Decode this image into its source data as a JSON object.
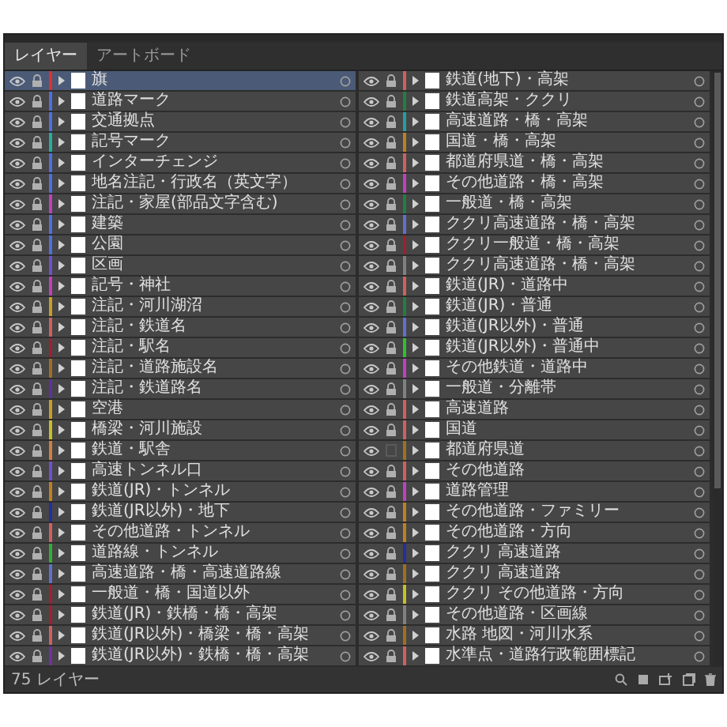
{
  "tabs": [
    {
      "label": "レイヤー",
      "selected": true
    },
    {
      "label": "アートボード",
      "selected": false
    }
  ],
  "layers": [
    {
      "name": "旗",
      "color": "#e03030",
      "locked": true,
      "selected": true
    },
    {
      "name": "道路マーク",
      "color": "#4f6fe0",
      "locked": true,
      "selected": false
    },
    {
      "name": "交通拠点",
      "color": "#4f6fe0",
      "locked": true,
      "selected": false
    },
    {
      "name": "記号マーク",
      "color": "#20b0a0",
      "locked": true,
      "selected": false
    },
    {
      "name": "インターチェンジ",
      "color": "#4f6fe0",
      "locked": true,
      "selected": false
    },
    {
      "name": "地名注記・行政名（英文字）",
      "color": "#4f6fe0",
      "locked": true,
      "selected": false
    },
    {
      "name": "注記・家屋(部品文字含む)",
      "color": "#c040c0",
      "locked": true,
      "selected": false
    },
    {
      "name": "建築",
      "color": "#4f6fe0",
      "locked": true,
      "selected": false
    },
    {
      "name": "公園",
      "color": "#4f6fe0",
      "locked": true,
      "selected": false
    },
    {
      "name": "区画",
      "color": "#7050d0",
      "locked": true,
      "selected": false
    },
    {
      "name": "記号・神社",
      "color": "#c040c0",
      "locked": true,
      "selected": false
    },
    {
      "name": "注記・河川湖沼",
      "color": "#c8a020",
      "locked": true,
      "selected": false
    },
    {
      "name": "注記・鉄道名",
      "color": "#d06060",
      "locked": true,
      "selected": false
    },
    {
      "name": "注記・駅名",
      "color": "#a02030",
      "locked": true,
      "selected": false
    },
    {
      "name": "注記・道路施設名",
      "color": "#a07020",
      "locked": true,
      "selected": false
    },
    {
      "name": "注記・鉄道路名",
      "color": "#6030a0",
      "locked": true,
      "selected": false
    },
    {
      "name": "空港",
      "color": "#c8a020",
      "locked": true,
      "selected": false
    },
    {
      "name": "橋梁・河川施設",
      "color": "#c8c020",
      "locked": true,
      "selected": false
    },
    {
      "name": "鉄道・駅舎",
      "color": "#d08040",
      "locked": true,
      "selected": false
    },
    {
      "name": "高速トンネル口",
      "color": "#7050d0",
      "locked": true,
      "selected": false
    },
    {
      "name": "鉄道(JR)・トンネル",
      "color": "#c08020",
      "locked": true,
      "selected": false
    },
    {
      "name": "鉄道(JR以外)・地下",
      "color": "#2030a0",
      "locked": true,
      "selected": false
    },
    {
      "name": "その他道路・トンネル",
      "color": "#d06060",
      "locked": true,
      "selected": false
    },
    {
      "name": "道路線・トンネル",
      "color": "#30b030",
      "locked": true,
      "selected": false
    },
    {
      "name": "高速道路・橋・高速道路線",
      "color": "#6070d0",
      "locked": true,
      "selected": false
    },
    {
      "name": "一般道・橋・国道以外",
      "color": "#a02030",
      "locked": true,
      "selected": false
    },
    {
      "name": "鉄道(JR)・鉄橋・橋・高架",
      "color": "#a02030",
      "locked": true,
      "selected": false
    },
    {
      "name": "鉄道(JR以外)・橋梁・橋・高架",
      "color": "#d06060",
      "locked": true,
      "selected": false
    },
    {
      "name": "鉄道(JR以外)・鉄橋・橋・高架",
      "color": "#7030a0",
      "locked": true,
      "selected": false
    },
    {
      "name": "鉄道(地下)・高架",
      "color": "#d06060",
      "locked": true,
      "selected": false
    },
    {
      "name": "鉄道高架・ククリ",
      "color": "#208040",
      "locked": true,
      "selected": false
    },
    {
      "name": "高速道路・橋・高架",
      "color": "#20a0a0",
      "locked": true,
      "selected": false
    },
    {
      "name": "国道・橋・高架",
      "color": "#c08020",
      "locked": true,
      "selected": false
    },
    {
      "name": "都道府県道・橋・高架",
      "color": "#d06060",
      "locked": true,
      "selected": false
    },
    {
      "name": "その他道路・橋・高架",
      "color": "#c040c0",
      "locked": true,
      "selected": false
    },
    {
      "name": "一般道・橋・高架",
      "color": "#208040",
      "locked": true,
      "selected": false
    },
    {
      "name": "ククリ高速道路・橋・高架",
      "color": "#6070d0",
      "locked": true,
      "selected": false
    },
    {
      "name": "ククリ一般道・橋・高架",
      "color": "#a02030",
      "locked": true,
      "selected": false
    },
    {
      "name": "ククリ高速道路・橋・高架",
      "color": "#808080",
      "locked": true,
      "selected": false
    },
    {
      "name": "鉄道(JR)・道路中",
      "color": "#d06060",
      "locked": true,
      "selected": false
    },
    {
      "name": "鉄道(JR)・普通",
      "color": "#208040",
      "locked": true,
      "selected": false
    },
    {
      "name": "鉄道(JR以外)・普通",
      "color": "#6070d0",
      "locked": true,
      "selected": false
    },
    {
      "name": "鉄道(JR以外)・普通中",
      "color": "#30c030",
      "locked": true,
      "selected": false
    },
    {
      "name": "その他鉄道・道路中",
      "color": "#c040c0",
      "locked": true,
      "selected": false
    },
    {
      "name": "一般道・分離帯",
      "color": "#808080",
      "locked": true,
      "selected": false
    },
    {
      "name": "高速道路",
      "color": "#d06060",
      "locked": true,
      "selected": false
    },
    {
      "name": "国道",
      "color": "#d06060",
      "locked": true,
      "selected": false
    },
    {
      "name": "都道府県道",
      "color": "#a07020",
      "locked": false,
      "selected": false
    },
    {
      "name": "その他道路",
      "color": "#d06060",
      "locked": true,
      "selected": false
    },
    {
      "name": "道路管理",
      "color": "#c040c0",
      "locked": true,
      "selected": false
    },
    {
      "name": "その他道路・ファミリー",
      "color": "#c08020",
      "locked": true,
      "selected": false
    },
    {
      "name": "その他道路・方向",
      "color": "#c08020",
      "locked": true,
      "selected": false
    },
    {
      "name": "ククリ 高速道路",
      "color": "#2030a0",
      "locked": true,
      "selected": false
    },
    {
      "name": "ククリ 高速道路",
      "color": "#a07020",
      "locked": true,
      "selected": false
    },
    {
      "name": "ククリ その他道路・方向",
      "color": "#c8c020",
      "locked": true,
      "selected": false
    },
    {
      "name": "その他道路・区画線",
      "color": "#808080",
      "locked": true,
      "selected": false
    },
    {
      "name": "水路 地図・河川水系",
      "color": "#a07020",
      "locked": true,
      "selected": false
    },
    {
      "name": "水準点・道路行政範囲標記",
      "color": "#d06060",
      "locked": true,
      "selected": false
    }
  ],
  "status_bar": {
    "count": "75 レイヤー"
  }
}
